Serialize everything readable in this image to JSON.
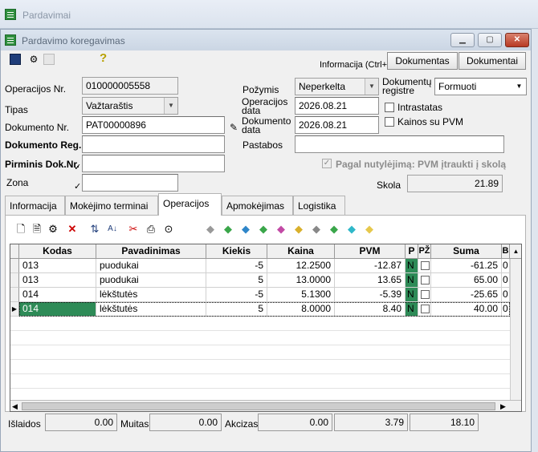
{
  "outer_window": {
    "title": "Pardavimai"
  },
  "inner_window": {
    "title": "Pardavimo koregavimas",
    "minimize": "▁",
    "maximize": "▢",
    "close": "✕"
  },
  "toolbar": {
    "info_text": "Informacija (Ctrl+",
    "dokumentas_label": "Dokumentas",
    "dokumentai_label": "Dokumentai",
    "icons": [
      "save-icon",
      "tools-icon",
      "copy-icon",
      "help-icon"
    ]
  },
  "form": {
    "operacijos_nr_label": "Operacijos Nr.",
    "operacijos_nr_value": "010000005558",
    "tipas_label": "Tipas",
    "tipas_value": "Važtaraštis",
    "dokumento_nr_label": "Dokumento Nr.",
    "dokumento_nr_value": "PAT00000896",
    "dokumento_reg_label": "Dokumento Reg.",
    "dokumento_reg_value": "",
    "pirminis_label": "Pirminis Dok.Nr.",
    "pirminis_value": "",
    "zona_label": "Zona",
    "zona_value": "",
    "pozymis_label": "Požymis",
    "pozymis_value": "Neperkelta",
    "op_data_label_1": "Operacijos",
    "op_data_label_2": "data",
    "op_data_value": "2026.08.21",
    "dok_data_label_1": "Dokumento",
    "dok_data_label_2": "data",
    "dok_data_value": "2026.08.21",
    "pastabos_label": "Pastabos",
    "pastabos_value": "",
    "dok_registre_label_1": "Dokumentų",
    "dok_registre_label_2": "registre",
    "dok_registre_value": "Formuoti",
    "intrastatas_label": "Intrastatas",
    "kainos_pvm_label": "Kainos su PVM",
    "pagal_label": "Pagal nutylėjimą: PVM įtraukti į skolą",
    "skola_label": "Skola",
    "skola_value": "21.89"
  },
  "tabs": [
    "Informacija",
    "Mokėjimo terminai",
    "Operacijos",
    "Apmokėjimas",
    "Logistika"
  ],
  "active_tab": "Operacijos",
  "grid": {
    "columns": [
      "Kodas",
      "Pavadinimas",
      "Kiekis",
      "Kaina",
      "PVM",
      "P",
      "PŽ",
      "Suma",
      "B"
    ],
    "rows": [
      {
        "kodas": "013",
        "pavadinimas": "puodukai",
        "kiekis": "-5",
        "kaina": "12.2500",
        "pvm": "-12.87",
        "p": "N",
        "suma": "-61.25",
        "b": "0"
      },
      {
        "kodas": "013",
        "pavadinimas": "puodukai",
        "kiekis": "5",
        "kaina": "13.0000",
        "pvm": "13.65",
        "p": "N",
        "suma": "65.00",
        "b": "0"
      },
      {
        "kodas": "014",
        "pavadinimas": "lėkštutės",
        "kiekis": "-5",
        "kaina": "5.1300",
        "pvm": "-5.39",
        "p": "N",
        "suma": "-25.65",
        "b": "0"
      },
      {
        "kodas": "014",
        "pavadinimas": "lėkštutės",
        "kiekis": "5",
        "kaina": "8.0000",
        "pvm": "8.40",
        "p": "N",
        "suma": "40.00",
        "b": "0"
      }
    ]
  },
  "totals": {
    "islaidos_label": "Išlaidos",
    "islaidos_value": "0.00",
    "muitas_label": "Muitas",
    "muitas_value": "0.00",
    "akcizas_label": "Akcizas",
    "akcizas_value": "0.00",
    "pvm_total": "3.79",
    "suma_total": "18.10"
  }
}
